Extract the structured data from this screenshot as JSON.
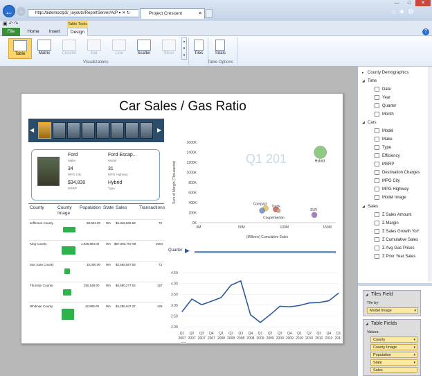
{
  "browser": {
    "address": "http://bidemoctp3/_layouts/ReportServer/Ad",
    "tab_title": "Project Crescent",
    "address_icons": "P ▾ ✕ ↻"
  },
  "ribbon": {
    "context_label": "Table Tools",
    "tabs": [
      "File",
      "Home",
      "Insert",
      "Design"
    ],
    "buttons": {
      "table": "Table",
      "matrix": "Matrix",
      "column": "Column",
      "bar": "Bar",
      "line": "Line",
      "scatter": "Scatter",
      "slicer": "Slicer",
      "tiles": "Tiles",
      "totals": "Totals"
    },
    "groups": {
      "visualizations": "Visualizations",
      "table_options": "Table Options"
    }
  },
  "report": {
    "title": "Car Sales / Gas Ratio",
    "card": {
      "make_value": "Ford",
      "make_label": "Make",
      "model_value": "Ford Escap...",
      "model_label": "Model",
      "mpg_city_value": "34",
      "mpg_city_label": "MPG City",
      "mpg_highway_value": "31",
      "mpg_highway_label": "MPG Highway",
      "msrp_value": "$34,830",
      "msrp_label": "MSRP",
      "type_value": "Hybrid",
      "type_label": "Type"
    },
    "table": {
      "headers": [
        "County",
        "County Image",
        "Population",
        "State",
        "Sales",
        "Transactions"
      ],
      "rows": [
        {
          "county": "Jefferson County",
          "population": "30,024.00",
          "state": "WA",
          "sales": "$2,346,506.63",
          "transactions": "70"
        },
        {
          "county": "King County",
          "population": "1,936,894.00",
          "state": "WA",
          "sales": "$67,093,767.99",
          "transactions": "2004"
        },
        {
          "county": "San Juan County",
          "population": "16,030.00",
          "state": "WA",
          "sales": "$2,565,567.93",
          "transactions": "73"
        },
        {
          "county": "Thurston County",
          "population": "255,549.00",
          "state": "WA",
          "sales": "$5,590,277.02",
          "transactions": "167"
        },
        {
          "county": "Whitman County",
          "population": "42,909.00",
          "state": "WA",
          "sales": "$4,285,947.27",
          "transactions": "126"
        }
      ]
    },
    "quarter_label": "Quarter",
    "play_icon": "▶"
  },
  "chart_data": [
    {
      "type": "scatter",
      "watermark": "Q1 201",
      "ylabel": "Sum of Margin (Thousands)",
      "xlabel": "(Millions) Cumulative Sales",
      "x_ticks": [
        "0M",
        "50M",
        "100M",
        "150M"
      ],
      "y_ticks": [
        "0K",
        "200K",
        "400K",
        "600K",
        "800K",
        "1000K",
        "1200K",
        "1400K",
        "1600K"
      ],
      "xlim": [
        0,
        160
      ],
      "ylim": [
        0,
        1600
      ],
      "points": [
        {
          "label": "Hybrid",
          "x": 142,
          "y": 1400,
          "r": 9,
          "color": "#7cc36f"
        },
        {
          "label": "Compact",
          "x": 78,
          "y": 285,
          "r": 4,
          "color": "#e8c24a"
        },
        {
          "label": "Truck",
          "x": 90,
          "y": 265,
          "r": 4,
          "color": "#d45a5a"
        },
        {
          "label": "",
          "x": 74,
          "y": 240,
          "r": 4,
          "color": "#6a8fc9"
        },
        {
          "label": "Coupe/Sedan",
          "x": 93,
          "y": 240,
          "r": 3,
          "color": "#c9a66a"
        },
        {
          "label": "SUV",
          "x": 135,
          "y": 155,
          "r": 4,
          "color": "#9a6ab0"
        }
      ]
    },
    {
      "type": "line",
      "y_ticks": [
        "2.00",
        "2.50",
        "3.00",
        "3.50",
        "4.00",
        "4.50"
      ],
      "ylim": [
        2.0,
        4.5
      ],
      "categories": [
        "Q1 2007",
        "Q2 2007",
        "Q3 2007",
        "Q4 2007",
        "Q1 2008",
        "Q2 2008",
        "Q3 2008",
        "Q4 2008",
        "Q1 2009",
        "Q2 2009",
        "Q3 2009",
        "Q4 2009",
        "Q1 2010",
        "Q2 2010",
        "Q3 2010",
        "Q4 2010",
        "Q1 2011"
      ],
      "values": [
        2.7,
        3.28,
        3.02,
        3.18,
        3.35,
        3.92,
        4.12,
        2.55,
        2.2,
        2.55,
        2.95,
        2.92,
        2.98,
        3.1,
        3.12,
        3.2,
        3.55
      ],
      "color": "#2b5aa0"
    }
  ],
  "fields_panel": {
    "root": "County Demographics",
    "groups": [
      {
        "name": "Time",
        "items": [
          "Date",
          "Year",
          "Quarter",
          "Month"
        ]
      },
      {
        "name": "Cars",
        "items": [
          "Model",
          "Make",
          "Type",
          "Efficiency",
          "MSRP",
          "Destination Charges",
          "MPG City",
          "MPG Highway",
          "Model Image"
        ]
      },
      {
        "name": "Sales",
        "items": [
          "Σ Sales Amount",
          "Σ Margin",
          "Σ Sales Growth YoY",
          "Σ Cumulative Sales",
          "Σ Avg Gas Prices",
          "Σ Prior Year Sales"
        ]
      }
    ],
    "tiles_field": {
      "title": "Tiles Field",
      "tile_by": "Tile by:",
      "value": "Model Image"
    },
    "table_fields": {
      "title": "Table Fields",
      "values_label": "Values:",
      "items": [
        "County",
        "County Image",
        "Population",
        "State",
        "Sales"
      ]
    }
  }
}
